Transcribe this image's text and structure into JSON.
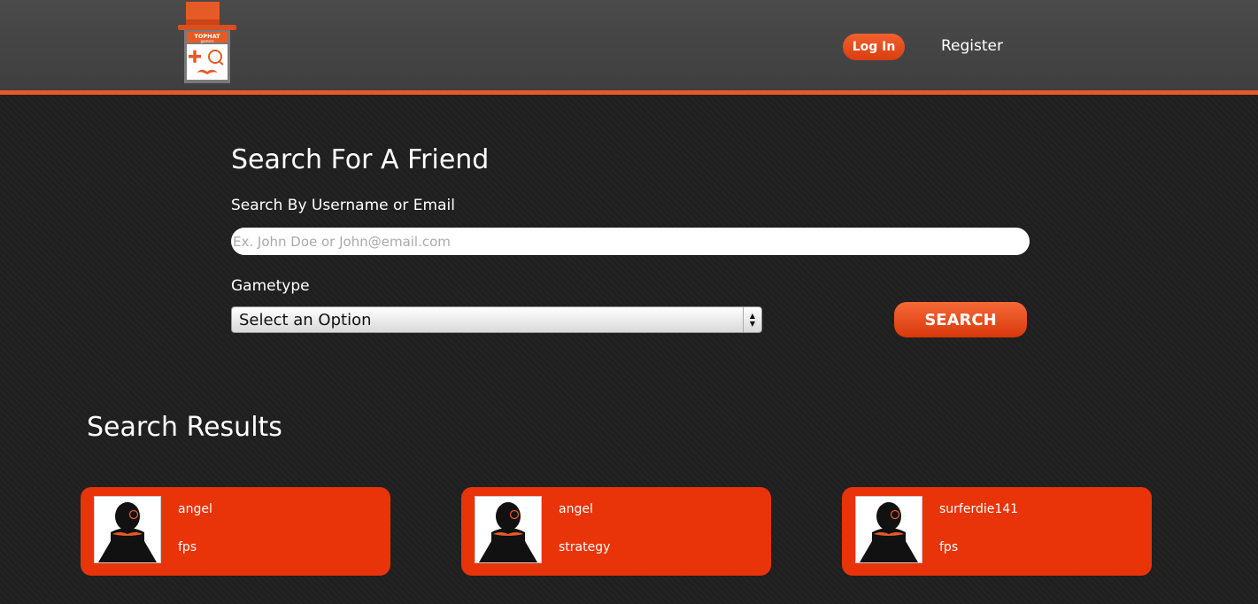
{
  "header": {
    "logo_text": "TOPHAT",
    "logo_subtext": "gamers",
    "login_label": "Log In",
    "register_label": "Register"
  },
  "search": {
    "title": "Search For A Friend",
    "username_label": "Search By Username or Email",
    "username_placeholder": "Ex. John Doe or John@email.com",
    "username_value": "",
    "gametype_label": "Gametype",
    "gametype_selected": "Select an Option",
    "search_button": "SEARCH"
  },
  "results": {
    "title": "Search Results",
    "items": [
      {
        "username": "angel",
        "gametype": "fps"
      },
      {
        "username": "angel",
        "gametype": "strategy"
      },
      {
        "username": "surferdie141",
        "gametype": "fps"
      }
    ]
  },
  "colors": {
    "accent": "#e8582a",
    "card": "#e93309",
    "header_bg": "#454545",
    "page_bg": "#1f1f1f"
  }
}
